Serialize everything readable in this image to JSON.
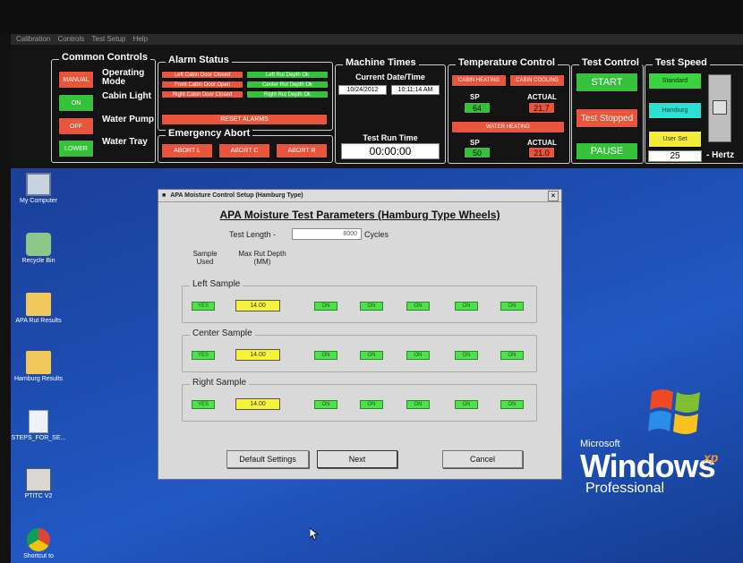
{
  "menubar": [
    "Calibration",
    "Controls",
    "Test Setup",
    "Help"
  ],
  "common_controls": {
    "title": "Common Controls",
    "rows": [
      {
        "button": "MANUAL",
        "label": "Operating Mode"
      },
      {
        "button": "ON",
        "label": "Cabin Light"
      },
      {
        "button": "OFF",
        "label": "Water Pump"
      },
      {
        "button": "LOWER",
        "label": "Water Tray"
      }
    ]
  },
  "alarm_status": {
    "title": "Alarm Status",
    "items_left": [
      "Left Cabin Door Closed",
      "Front Cabin Door Open",
      "Right Cabin Door Closed"
    ],
    "items_right": [
      "Left Rut Depth Ok",
      "Center Rut Depth Ok",
      "Right Rut Depth Ok"
    ],
    "reset_label": "RESET ALARMS"
  },
  "emergency_abort": {
    "title": "Emergency Abort",
    "buttons": [
      "ABORT L",
      "ABORT C",
      "ABORT R"
    ]
  },
  "machine_times": {
    "title": "Machine Times",
    "current_label": "Current Date/Time",
    "date": "10/24/2012",
    "time": "10:11:14 AM",
    "run_label": "Test Run Time",
    "run_value": "00:00:00"
  },
  "temperature": {
    "title": "Temperature Control",
    "cabin_heating": "CABIN HEATING",
    "cabin_cooling": "CABIN COOLING",
    "sp_label": "SP",
    "actual_label": "ACTUAL",
    "cabin_sp": "64",
    "cabin_actual": "21.7",
    "water_heating": "WATER HEATING",
    "water_sp": "50",
    "water_actual": "21.0"
  },
  "test_control": {
    "title": "Test Control",
    "start": "START",
    "status": "Test Stopped",
    "pause": "PAUSE"
  },
  "test_speed": {
    "title": "Test Speed",
    "standard": "Standard",
    "hamburg": "Hamburg",
    "user_set": "User Set",
    "value": "25",
    "unit": "- Hertz"
  },
  "desktop": {
    "icons": [
      "My Computer",
      "Recycle Bin",
      "APA Rut Results",
      "Hamburg Results",
      "STEPS_FOR_SE...",
      "PTITC V2",
      "Shortcut to"
    ],
    "os_brand": "Microsoft",
    "os_name": "Windows",
    "os_sup": "xp",
    "os_edition": "Professional"
  },
  "dialog": {
    "title": "APA Moisture Control Setup (Hamburg Type)",
    "close": "×",
    "heading": "APA Moisture Test Parameters (Hamburg Type Wheels)",
    "test_length_label": "Test Length -",
    "test_length_value": "8000",
    "cycles_label": "Cycles",
    "col_sample_used": "Sample Used",
    "col_max_rut": "Max Rut Depth (MM)",
    "samples": [
      {
        "name": "Left Sample",
        "used": "YES",
        "depth": "14.00",
        "ons": [
          "ON",
          "ON",
          "ON",
          "ON",
          "ON"
        ]
      },
      {
        "name": "Center Sample",
        "used": "YES",
        "depth": "14.00",
        "ons": [
          "ON",
          "ON",
          "ON",
          "ON",
          "ON"
        ]
      },
      {
        "name": "Right Sample",
        "used": "YES",
        "depth": "14.00",
        "ons": [
          "ON",
          "ON",
          "ON",
          "ON",
          "ON"
        ]
      }
    ],
    "default_btn": "Default Settings",
    "next_btn": "Next",
    "cancel_btn": "Cancel"
  },
  "colors": {
    "panel_bg": "#141414",
    "desktop_bg": "#1d4db0",
    "alarm_red": "#e8553a",
    "ok_green": "#35c23a"
  }
}
